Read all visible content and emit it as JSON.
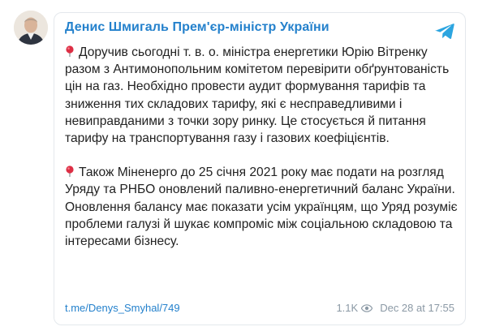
{
  "post": {
    "channel_name": "Денис Шмигаль Прем'єр-міністр України",
    "paragraphs": [
      "Доручив сьогодні т. в. о. міністра енергетики Юрію Вітренку разом з Антимонопольним комітетом перевірити обґрунтованість цін на газ. Необхідно провести аудит формування тарифів та зниження тих складових тарифу, які є несправедливими і невиправданими з точки зору ринку. Це стосується й питання тарифу на транспортування газу і газових коефіцієнтів.",
      "Також Міненерго до 25 січня 2021 року має подати на розгляд Уряду та РНБО оновлений паливно-енергетичний баланс України. Оновлення балансу має показати усім українцям, що Уряд розуміє проблеми галузі й шукає компроміс між соціальною складовою та інтересами бізнесу."
    ],
    "link": "t.me/Denys_Smyhal/749",
    "views": "1.1K",
    "timestamp": "Dec 28 at 17:55"
  },
  "icons": {
    "avatar": "avatar",
    "telegram": "telegram-icon",
    "pin": "round-pushpin-icon",
    "views": "eye-icon"
  },
  "colors": {
    "accent": "#2481cc",
    "text": "#222222",
    "muted": "#8b99a5",
    "border": "#e4e8ec",
    "pin": "#dd2e44"
  }
}
